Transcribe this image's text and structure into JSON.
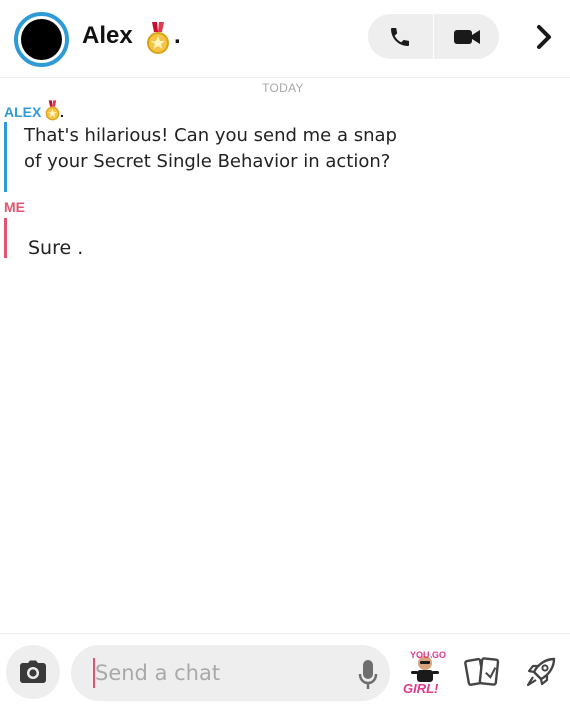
{
  "header": {
    "name": "Alex",
    "dot": ".",
    "avatar_ring_color": "#2f9bd6",
    "icons": {
      "avatar": "avatar",
      "medal": "medal-icon",
      "call": "phone-icon",
      "video": "video-camera-icon",
      "forward": "chevron-right-icon"
    }
  },
  "conversation": {
    "day_label": "TODAY",
    "messages": [
      {
        "sender": "ALEX",
        "sender_dot": ".",
        "sender_color": "#2f9bd6",
        "text": "That's hilarious! Can you send me a snap of your Secret Single Behavior in action?"
      },
      {
        "sender": "ME",
        "sender_color": "#e0566e",
        "text": "Sure ."
      }
    ]
  },
  "composer": {
    "placeholder": "Send a chat",
    "icons": {
      "camera": "camera-icon",
      "mic": "microphone-icon",
      "bitmoji": "bitmoji-sticker",
      "stickers": "sticker-cards-icon",
      "games": "rocket-icon"
    },
    "bitmoji_text_top": "YOU GO",
    "bitmoji_text_bottom": "GIRL!"
  }
}
